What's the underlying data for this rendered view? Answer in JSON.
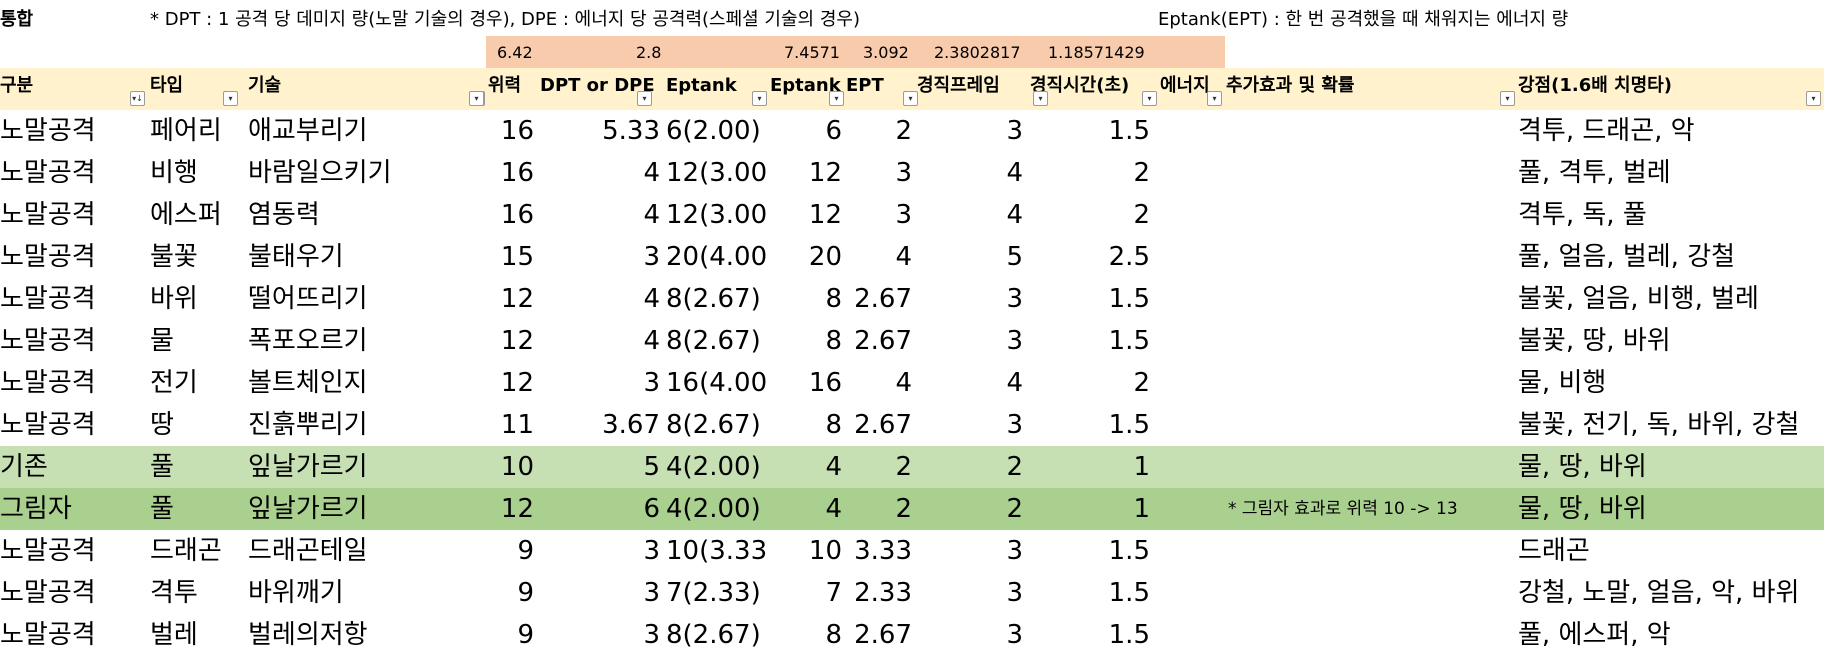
{
  "title_cell": "통합",
  "notes": [
    "* DPT : 1 공격 당 데미지 량(노말 기술의 경우), DPE : 에너지 당 공격력(스페셜 기술의 경우)",
    "Eptank(EPT) : 한 번 공격했을 때 채워지는 에너지 량"
  ],
  "summary_values": [
    "6.42",
    "2.8",
    "7.4571",
    "3.092",
    "2.3802817",
    "1.18571429"
  ],
  "headers": [
    "구분",
    "타입",
    "기술",
    "위력",
    "DPT or DPE",
    "Eptank",
    "Eptank",
    "EPT",
    "경직프레임",
    "경직시간(초)",
    "에너지",
    "추가효과 및 확률",
    "강점(1.6배 치명타)"
  ],
  "colors": {
    "header_bg": "#fff2cc",
    "summary_bg": "#f8cbad",
    "light_green": "#c6e0b4",
    "green": "#a9d08e"
  },
  "rows": [
    {
      "cat": "노말공격",
      "type": "페어리",
      "skill": "애교부리기",
      "power": "16",
      "dpt": "5.33",
      "eptank_text": "6(2.00)",
      "eptank": "6",
      "ept": "2",
      "frames": "3",
      "stun": "1.5",
      "energy": "",
      "effect": "",
      "strong": "격투, 드래곤, 악",
      "hl": ""
    },
    {
      "cat": "노말공격",
      "type": "비행",
      "skill": "바람일으키기",
      "power": "16",
      "dpt": "4",
      "eptank_text": "12(3.00)",
      "eptank": "12",
      "ept": "3",
      "frames": "4",
      "stun": "2",
      "energy": "",
      "effect": "",
      "strong": "풀, 격투, 벌레",
      "hl": ""
    },
    {
      "cat": "노말공격",
      "type": "에스퍼",
      "skill": "염동력",
      "power": "16",
      "dpt": "4",
      "eptank_text": "12(3.00)",
      "eptank": "12",
      "ept": "3",
      "frames": "4",
      "stun": "2",
      "energy": "",
      "effect": "",
      "strong": "격투, 독, 풀",
      "hl": ""
    },
    {
      "cat": "노말공격",
      "type": "불꽃",
      "skill": "불태우기",
      "power": "15",
      "dpt": "3",
      "eptank_text": "20(4.00)",
      "eptank": "20",
      "ept": "4",
      "frames": "5",
      "stun": "2.5",
      "energy": "",
      "effect": "",
      "strong": "풀, 얼음, 벌레, 강철",
      "hl": ""
    },
    {
      "cat": "노말공격",
      "type": "바위",
      "skill": "떨어뜨리기",
      "power": "12",
      "dpt": "4",
      "eptank_text": "8(2.67)",
      "eptank": "8",
      "ept": "2.67",
      "frames": "3",
      "stun": "1.5",
      "energy": "",
      "effect": "",
      "strong": "불꽃, 얼음, 비행, 벌레",
      "hl": ""
    },
    {
      "cat": "노말공격",
      "type": "물",
      "skill": "폭포오르기",
      "power": "12",
      "dpt": "4",
      "eptank_text": "8(2.67)",
      "eptank": "8",
      "ept": "2.67",
      "frames": "3",
      "stun": "1.5",
      "energy": "",
      "effect": "",
      "strong": "불꽃, 땅, 바위",
      "hl": ""
    },
    {
      "cat": "노말공격",
      "type": "전기",
      "skill": "볼트체인지",
      "power": "12",
      "dpt": "3",
      "eptank_text": "16(4.00)",
      "eptank": "16",
      "ept": "4",
      "frames": "4",
      "stun": "2",
      "energy": "",
      "effect": "",
      "strong": "물, 비행",
      "hl": ""
    },
    {
      "cat": "노말공격",
      "type": "땅",
      "skill": "진흙뿌리기",
      "power": "11",
      "dpt": "3.67",
      "eptank_text": "8(2.67)",
      "eptank": "8",
      "ept": "2.67",
      "frames": "3",
      "stun": "1.5",
      "energy": "",
      "effect": "",
      "strong": "불꽃, 전기, 독, 바위, 강철",
      "hl": ""
    },
    {
      "cat": "기존",
      "type": "풀",
      "skill": "잎날가르기",
      "power": "10",
      "dpt": "5",
      "eptank_text": "4(2.00)",
      "eptank": "4",
      "ept": "2",
      "frames": "2",
      "stun": "1",
      "energy": "",
      "effect": "",
      "strong": "물, 땅, 바위",
      "hl": "light"
    },
    {
      "cat": "그림자",
      "type": "풀",
      "skill": "잎날가르기",
      "power": "12",
      "dpt": "6",
      "eptank_text": "4(2.00)",
      "eptank": "4",
      "ept": "2",
      "frames": "2",
      "stun": "1",
      "energy": "",
      "effect": "* 그림자 효과로 위력 10 -> 13",
      "strong": "물, 땅, 바위",
      "hl": "green"
    },
    {
      "cat": "노말공격",
      "type": "드래곤",
      "skill": "드래곤테일",
      "power": "9",
      "dpt": "3",
      "eptank_text": "10(3.33)",
      "eptank": "10",
      "ept": "3.33",
      "frames": "3",
      "stun": "1.5",
      "energy": "",
      "effect": "",
      "strong": "드래곤",
      "hl": ""
    },
    {
      "cat": "노말공격",
      "type": "격투",
      "skill": "바위깨기",
      "power": "9",
      "dpt": "3",
      "eptank_text": "7(2.33)",
      "eptank": "7",
      "ept": "2.33",
      "frames": "3",
      "stun": "1.5",
      "energy": "",
      "effect": "",
      "strong": "강철, 노말, 얼음, 악, 바위",
      "hl": ""
    },
    {
      "cat": "노말공격",
      "type": "벌레",
      "skill": "벌레의저항",
      "power": "9",
      "dpt": "3",
      "eptank_text": "8(2.67)",
      "eptank": "8",
      "ept": "2.67",
      "frames": "3",
      "stun": "1.5",
      "energy": "",
      "effect": "",
      "strong": "풀, 에스퍼, 악",
      "hl": ""
    }
  ]
}
